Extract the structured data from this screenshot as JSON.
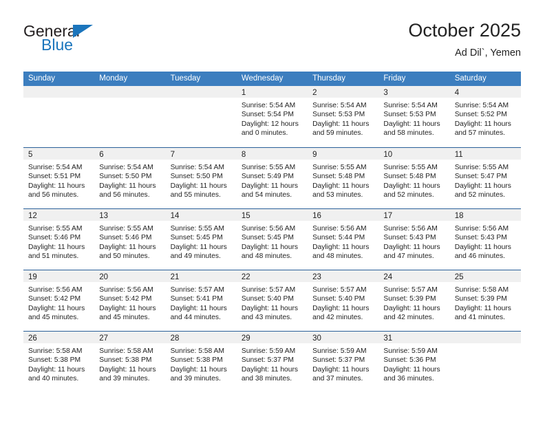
{
  "brand": {
    "word_one": "General",
    "word_two": "Blue",
    "triangle_color": "#1b75bc"
  },
  "header": {
    "title": "October 2025",
    "subtitle": "Ad Dil`, Yemen"
  },
  "theme": {
    "header_blue": "#3c7ebf",
    "row_divider_blue": "#2a6099",
    "day_band_gray": "#f0f0f0"
  },
  "weekdays": [
    "Sunday",
    "Monday",
    "Tuesday",
    "Wednesday",
    "Thursday",
    "Friday",
    "Saturday"
  ],
  "weeks": [
    [
      {
        "day": "",
        "lines": []
      },
      {
        "day": "",
        "lines": []
      },
      {
        "day": "",
        "lines": []
      },
      {
        "day": "1",
        "lines": [
          "Sunrise: 5:54 AM",
          "Sunset: 5:54 PM",
          "Daylight: 12 hours",
          "and 0 minutes."
        ]
      },
      {
        "day": "2",
        "lines": [
          "Sunrise: 5:54 AM",
          "Sunset: 5:53 PM",
          "Daylight: 11 hours",
          "and 59 minutes."
        ]
      },
      {
        "day": "3",
        "lines": [
          "Sunrise: 5:54 AM",
          "Sunset: 5:53 PM",
          "Daylight: 11 hours",
          "and 58 minutes."
        ]
      },
      {
        "day": "4",
        "lines": [
          "Sunrise: 5:54 AM",
          "Sunset: 5:52 PM",
          "Daylight: 11 hours",
          "and 57 minutes."
        ]
      }
    ],
    [
      {
        "day": "5",
        "lines": [
          "Sunrise: 5:54 AM",
          "Sunset: 5:51 PM",
          "Daylight: 11 hours",
          "and 56 minutes."
        ]
      },
      {
        "day": "6",
        "lines": [
          "Sunrise: 5:54 AM",
          "Sunset: 5:50 PM",
          "Daylight: 11 hours",
          "and 56 minutes."
        ]
      },
      {
        "day": "7",
        "lines": [
          "Sunrise: 5:54 AM",
          "Sunset: 5:50 PM",
          "Daylight: 11 hours",
          "and 55 minutes."
        ]
      },
      {
        "day": "8",
        "lines": [
          "Sunrise: 5:55 AM",
          "Sunset: 5:49 PM",
          "Daylight: 11 hours",
          "and 54 minutes."
        ]
      },
      {
        "day": "9",
        "lines": [
          "Sunrise: 5:55 AM",
          "Sunset: 5:48 PM",
          "Daylight: 11 hours",
          "and 53 minutes."
        ]
      },
      {
        "day": "10",
        "lines": [
          "Sunrise: 5:55 AM",
          "Sunset: 5:48 PM",
          "Daylight: 11 hours",
          "and 52 minutes."
        ]
      },
      {
        "day": "11",
        "lines": [
          "Sunrise: 5:55 AM",
          "Sunset: 5:47 PM",
          "Daylight: 11 hours",
          "and 52 minutes."
        ]
      }
    ],
    [
      {
        "day": "12",
        "lines": [
          "Sunrise: 5:55 AM",
          "Sunset: 5:46 PM",
          "Daylight: 11 hours",
          "and 51 minutes."
        ]
      },
      {
        "day": "13",
        "lines": [
          "Sunrise: 5:55 AM",
          "Sunset: 5:46 PM",
          "Daylight: 11 hours",
          "and 50 minutes."
        ]
      },
      {
        "day": "14",
        "lines": [
          "Sunrise: 5:55 AM",
          "Sunset: 5:45 PM",
          "Daylight: 11 hours",
          "and 49 minutes."
        ]
      },
      {
        "day": "15",
        "lines": [
          "Sunrise: 5:56 AM",
          "Sunset: 5:45 PM",
          "Daylight: 11 hours",
          "and 48 minutes."
        ]
      },
      {
        "day": "16",
        "lines": [
          "Sunrise: 5:56 AM",
          "Sunset: 5:44 PM",
          "Daylight: 11 hours",
          "and 48 minutes."
        ]
      },
      {
        "day": "17",
        "lines": [
          "Sunrise: 5:56 AM",
          "Sunset: 5:43 PM",
          "Daylight: 11 hours",
          "and 47 minutes."
        ]
      },
      {
        "day": "18",
        "lines": [
          "Sunrise: 5:56 AM",
          "Sunset: 5:43 PM",
          "Daylight: 11 hours",
          "and 46 minutes."
        ]
      }
    ],
    [
      {
        "day": "19",
        "lines": [
          "Sunrise: 5:56 AM",
          "Sunset: 5:42 PM",
          "Daylight: 11 hours",
          "and 45 minutes."
        ]
      },
      {
        "day": "20",
        "lines": [
          "Sunrise: 5:56 AM",
          "Sunset: 5:42 PM",
          "Daylight: 11 hours",
          "and 45 minutes."
        ]
      },
      {
        "day": "21",
        "lines": [
          "Sunrise: 5:57 AM",
          "Sunset: 5:41 PM",
          "Daylight: 11 hours",
          "and 44 minutes."
        ]
      },
      {
        "day": "22",
        "lines": [
          "Sunrise: 5:57 AM",
          "Sunset: 5:40 PM",
          "Daylight: 11 hours",
          "and 43 minutes."
        ]
      },
      {
        "day": "23",
        "lines": [
          "Sunrise: 5:57 AM",
          "Sunset: 5:40 PM",
          "Daylight: 11 hours",
          "and 42 minutes."
        ]
      },
      {
        "day": "24",
        "lines": [
          "Sunrise: 5:57 AM",
          "Sunset: 5:39 PM",
          "Daylight: 11 hours",
          "and 42 minutes."
        ]
      },
      {
        "day": "25",
        "lines": [
          "Sunrise: 5:58 AM",
          "Sunset: 5:39 PM",
          "Daylight: 11 hours",
          "and 41 minutes."
        ]
      }
    ],
    [
      {
        "day": "26",
        "lines": [
          "Sunrise: 5:58 AM",
          "Sunset: 5:38 PM",
          "Daylight: 11 hours",
          "and 40 minutes."
        ]
      },
      {
        "day": "27",
        "lines": [
          "Sunrise: 5:58 AM",
          "Sunset: 5:38 PM",
          "Daylight: 11 hours",
          "and 39 minutes."
        ]
      },
      {
        "day": "28",
        "lines": [
          "Sunrise: 5:58 AM",
          "Sunset: 5:38 PM",
          "Daylight: 11 hours",
          "and 39 minutes."
        ]
      },
      {
        "day": "29",
        "lines": [
          "Sunrise: 5:59 AM",
          "Sunset: 5:37 PM",
          "Daylight: 11 hours",
          "and 38 minutes."
        ]
      },
      {
        "day": "30",
        "lines": [
          "Sunrise: 5:59 AM",
          "Sunset: 5:37 PM",
          "Daylight: 11 hours",
          "and 37 minutes."
        ]
      },
      {
        "day": "31",
        "lines": [
          "Sunrise: 5:59 AM",
          "Sunset: 5:36 PM",
          "Daylight: 11 hours",
          "and 36 minutes."
        ]
      },
      {
        "day": "",
        "lines": []
      }
    ]
  ]
}
